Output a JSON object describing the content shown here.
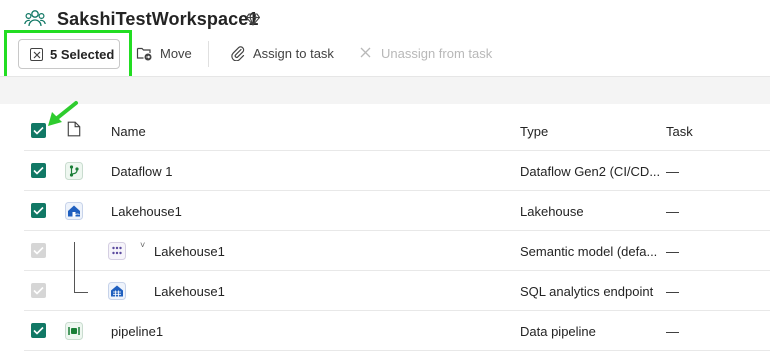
{
  "workspace": {
    "title": "SakshiTestWorkspace1",
    "icon": "people-group-icon",
    "badge_icon": "diamond-icon"
  },
  "toolbar": {
    "selected_label": "5 Selected",
    "move_label": "Move",
    "assign_label": "Assign to task",
    "unassign_label": "Unassign from task"
  },
  "table": {
    "headers": {
      "name": "Name",
      "type": "Type",
      "task": "Task"
    },
    "rows": [
      {
        "name": "Dataflow 1",
        "type": "Dataflow Gen2 (CI/CD...",
        "task": "—",
        "icon": "dataflow-icon",
        "checked": true,
        "disabled": false
      },
      {
        "name": "Lakehouse1",
        "type": "Lakehouse",
        "task": "—",
        "icon": "lakehouse-icon",
        "checked": true,
        "disabled": false
      },
      {
        "name": "Lakehouse1",
        "type": "Semantic model (defa...",
        "task": "—",
        "icon": "semantic-model-icon",
        "checked": true,
        "disabled": true
      },
      {
        "name": "Lakehouse1",
        "type": "SQL analytics endpoint",
        "task": "—",
        "icon": "sql-endpoint-icon",
        "checked": true,
        "disabled": true
      },
      {
        "name": "pipeline1",
        "type": "Data pipeline",
        "task": "—",
        "icon": "pipeline-icon",
        "checked": true,
        "disabled": false
      }
    ]
  },
  "colors": {
    "checkbox": "#117865",
    "checkbox_disabled": "#d6d6d6",
    "highlight": "#22dd22",
    "annotation_arrow": "#2ecc2e"
  }
}
